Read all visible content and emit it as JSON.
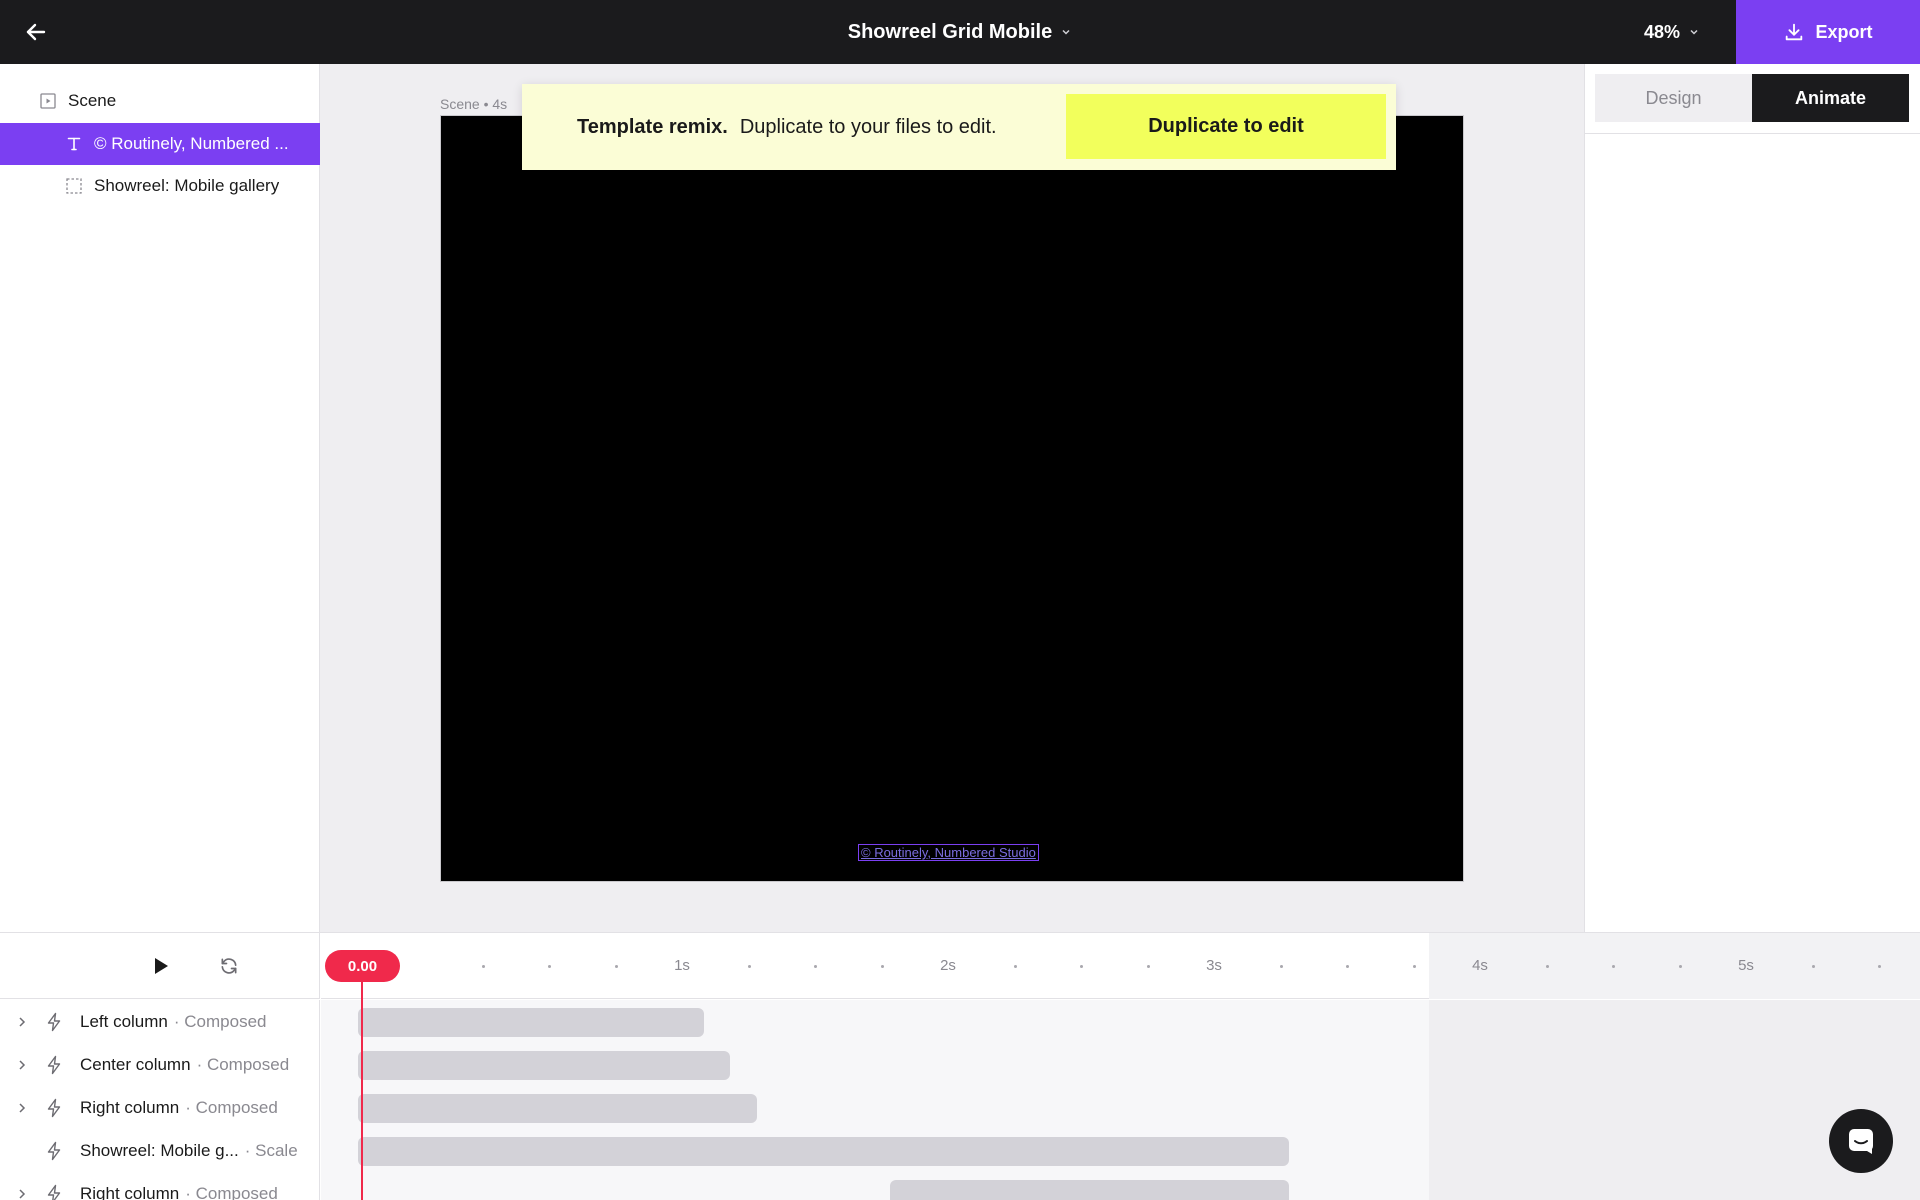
{
  "header": {
    "title": "Showreel Grid Mobile",
    "zoom": "48%",
    "export_label": "Export"
  },
  "layers": {
    "items": [
      {
        "label": "Scene",
        "icon": "scene-icon",
        "selected": false
      },
      {
        "label": "© Routinely, Numbered ...",
        "icon": "text-icon",
        "selected": true
      },
      {
        "label": "Showreel: Mobile gallery",
        "icon": "frame-icon",
        "selected": false
      }
    ]
  },
  "canvas": {
    "scene_label": "Scene • 4s",
    "credit": "© Routinely, Numbered Studio"
  },
  "banner": {
    "strong": "Template remix.",
    "text": "Duplicate to your files to edit.",
    "button": "Duplicate to edit"
  },
  "right_panel": {
    "tabs": [
      {
        "label": "Design",
        "active": false
      },
      {
        "label": "Animate",
        "active": true
      }
    ]
  },
  "timeline": {
    "playhead": "0.00",
    "seconds": [
      "1s",
      "2s",
      "3s",
      "4s",
      "5s"
    ],
    "duration_s": 4,
    "rows": [
      {
        "name": "Left column",
        "kind": "· Composed",
        "expandable": true,
        "start": 0,
        "end": 1.3
      },
      {
        "name": "Center column",
        "kind": "· Composed",
        "expandable": true,
        "start": 0,
        "end": 1.4
      },
      {
        "name": "Right column",
        "kind": "· Composed",
        "expandable": true,
        "start": 0,
        "end": 1.5
      },
      {
        "name": "Showreel: Mobile g...",
        "kind": "· Scale",
        "expandable": false,
        "start": 0,
        "end": 3.5
      },
      {
        "name": "Right column",
        "kind": "· Composed",
        "expandable": true,
        "start": 2.0,
        "end": 3.5
      }
    ]
  },
  "colors": {
    "accent": "#7b3ff2",
    "playhead": "#f0294b",
    "banner_bg": "#fbfdd6",
    "banner_button": "#f2ff5c"
  }
}
